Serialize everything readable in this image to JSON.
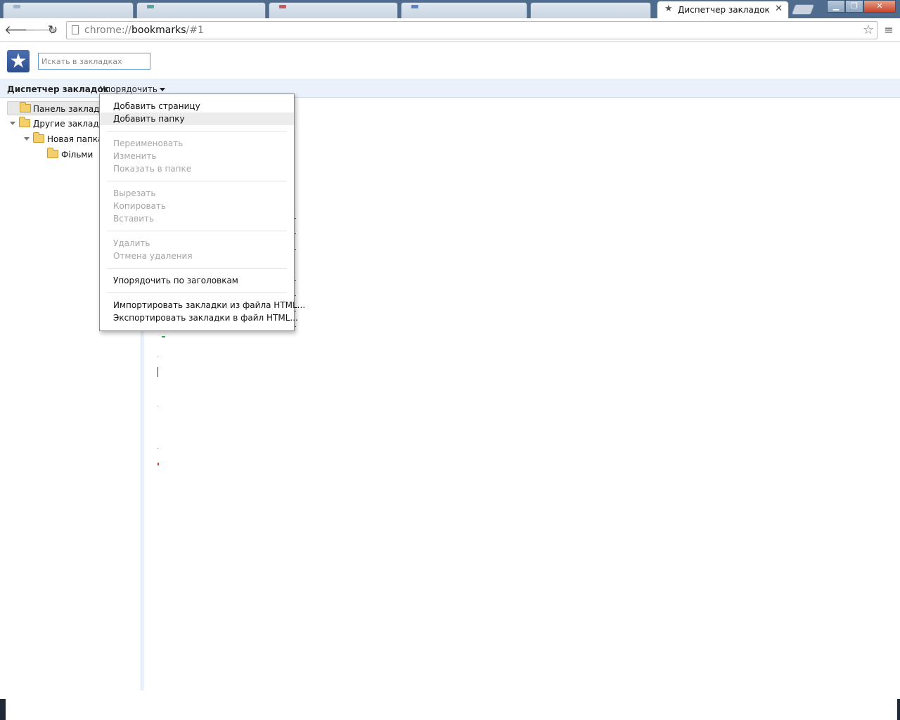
{
  "tabs": {
    "active_title": "Диспетчер закладок",
    "active_icon": "star-icon",
    "inactive_count": 5
  },
  "toolbar": {
    "url_scheme": "chrome://",
    "url_host": "bookmarks",
    "url_path": "/#1"
  },
  "header": {
    "search_placeholder": "Искать в закладках"
  },
  "commandbar": {
    "title": "Диспетчер закладок",
    "organize_label": "Упорядочить"
  },
  "tree": {
    "items": [
      {
        "label": "Панель закладок",
        "selected": true
      },
      {
        "label": "Другие закладки",
        "expanded": true
      },
      {
        "label": "Новая папка",
        "expanded": true
      },
      {
        "label": "Фільми"
      }
    ]
  },
  "menu": {
    "groups": [
      [
        {
          "label": "Добавить страницу",
          "enabled": true
        },
        {
          "label": "Добавить папку",
          "enabled": true,
          "hover": true
        }
      ],
      [
        {
          "label": "Переименовать",
          "enabled": false
        },
        {
          "label": "Изменить",
          "enabled": false
        },
        {
          "label": "Показать в папке",
          "enabled": false
        }
      ],
      [
        {
          "label": "Вырезать",
          "enabled": false
        },
        {
          "label": "Копировать",
          "enabled": false
        },
        {
          "label": "Вставить",
          "enabled": false
        }
      ],
      [
        {
          "label": "Удалить",
          "enabled": false
        },
        {
          "label": "Отмена удаления",
          "enabled": false
        }
      ],
      [
        {
          "label": "Упорядочить по заголовкам",
          "enabled": true
        }
      ],
      [
        {
          "label": "Импортировать закладки из файла HTML...",
          "enabled": true
        },
        {
          "label": "Экспортировать закладки в файл HTML...",
          "enabled": true
        }
      ]
    ]
  },
  "colors": {
    "tabstrip": "#4f6c8f",
    "accent": "#5b9bd5",
    "cmdbar": "#ebf1fa"
  }
}
